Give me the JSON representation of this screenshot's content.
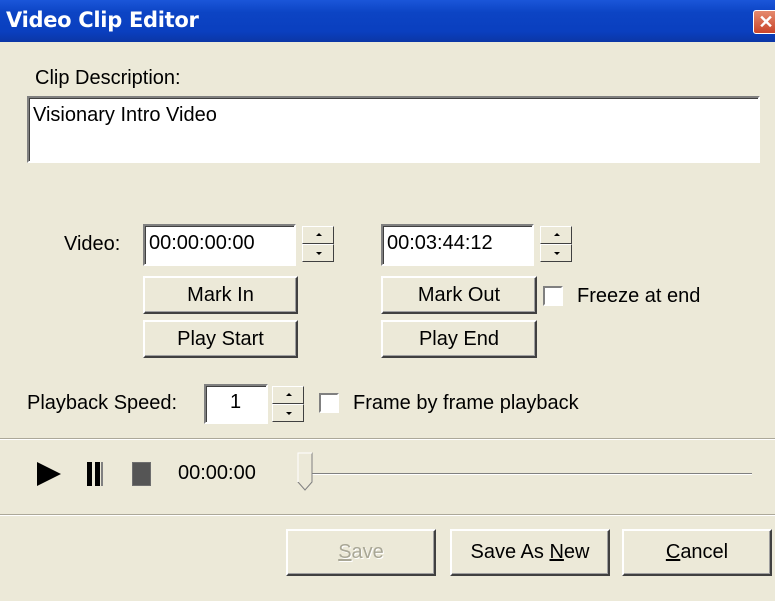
{
  "window": {
    "title": "Video Clip Editor",
    "close_glyph": "✕"
  },
  "description": {
    "label": "Clip Description:",
    "value": "Visionary Intro Video"
  },
  "video": {
    "label": "Video:",
    "in_time": "00:00:00:00",
    "out_time": "00:03:44:12",
    "mark_in": "Mark In",
    "mark_out": "Mark Out",
    "play_start": "Play Start",
    "play_end": "Play End",
    "freeze_label": "Freeze at end",
    "freeze_checked": false
  },
  "playback": {
    "speed_label": "Playback Speed:",
    "speed_value": "1",
    "frame_by_frame_label": "Frame by frame playback",
    "frame_by_frame_checked": false
  },
  "transport": {
    "play_icon": "play-icon",
    "pause_icon": "pause-icon",
    "stop_icon": "stop-icon",
    "time": "00:00:00",
    "position_fraction": 0
  },
  "footer": {
    "save": {
      "pre": "",
      "key": "S",
      "post": "ave",
      "enabled": false
    },
    "save_as_new": {
      "pre": "Save As ",
      "key": "N",
      "post": "ew",
      "enabled": true
    },
    "cancel": {
      "pre": "",
      "key": "C",
      "post": "ancel",
      "enabled": true
    }
  },
  "colors": {
    "titlebar": "#0a3fbf",
    "dialog_bg": "#ece9d8",
    "close": "#c9442a"
  }
}
